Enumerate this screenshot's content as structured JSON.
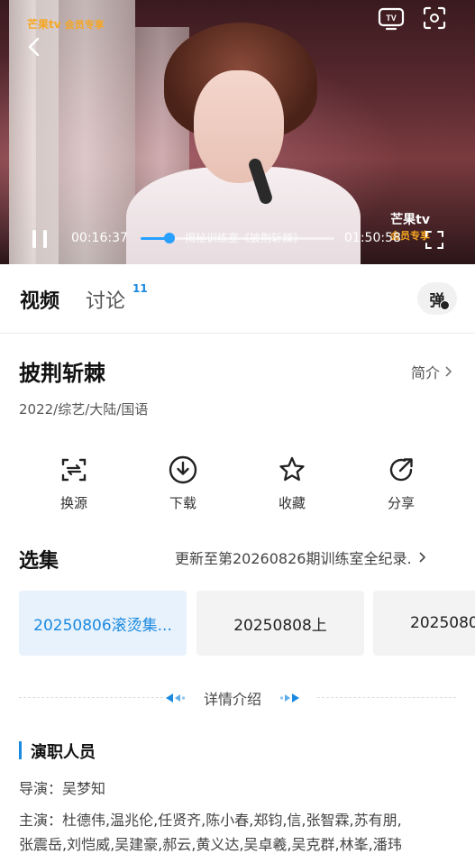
{
  "player": {
    "logo_text": "芒果tv",
    "logo_badge": "会员专享",
    "current_time": "00:16:37",
    "duration": "01:50:58",
    "progress_fraction": 0.15,
    "caption_text": "揭秘训练室《披荆斩棘》",
    "watermark_text": "芒果tv",
    "watermark_badge": "会员专享"
  },
  "tabs": [
    {
      "label": "视频",
      "active": true
    },
    {
      "label": "讨论",
      "badge": "11",
      "active": false
    }
  ],
  "danmaku_toggle": "弹",
  "show": {
    "title": "披荆斩棘",
    "intro_link": "简介",
    "meta": "2022/综艺/大陆/国语"
  },
  "actions": [
    {
      "label": "换源",
      "icon": "switch-source-icon"
    },
    {
      "label": "下载",
      "icon": "download-icon"
    },
    {
      "label": "收藏",
      "icon": "star-icon"
    },
    {
      "label": "分享",
      "icon": "share-icon"
    }
  ],
  "episodes": {
    "heading": "选集",
    "update_text": "更新至第20260826期训练室全纪录.",
    "items": [
      "20250806滚烫集...",
      "20250808上",
      "2025080"
    ]
  },
  "details_toggle": "详情介绍",
  "cast": {
    "heading": "演职人员",
    "director_line": "导演：吴梦知",
    "starring_line": "主演：杜德伟,温兆伦,任贤齐,陈小春,郑钧,信,张智霖,苏有朋,",
    "starring_line2": "张震岳,刘恺威,吴建豪,郝云,黄义达,吴卓羲,吴克群,林峯,潘玮"
  },
  "colors": {
    "accent": "#1a8ae0",
    "progress": "#27a0ff"
  }
}
